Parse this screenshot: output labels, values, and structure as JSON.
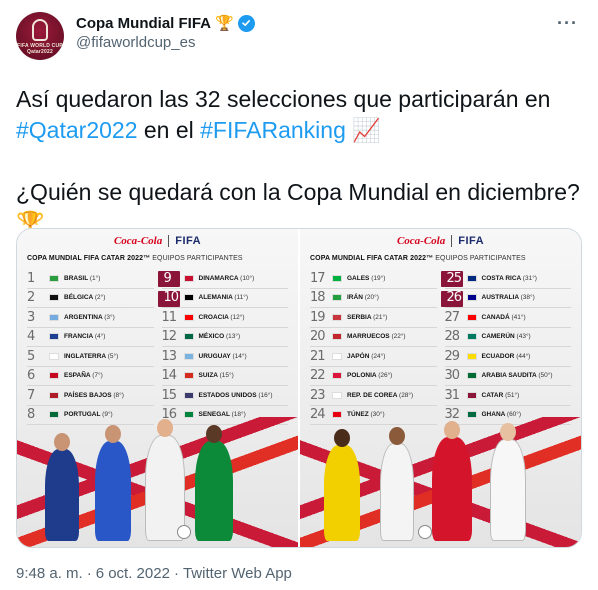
{
  "account": {
    "display_name": "Copa Mundial FIFA",
    "badge_emoji": "🏆",
    "handle": "@fifaworldcup_es",
    "avatar_text_1": "FIFA WORLD CUP",
    "avatar_text_2": "Qatar2022",
    "avatar_color": "#6d1027",
    "verified_color": "#1d9bf0"
  },
  "more_label": "···",
  "tweet": {
    "line1_a": "Así quedaron las 32 selecciones que participarán en",
    "hashtag1": "#Qatar2022",
    "line2_mid": " en el ",
    "hashtag2": "#FIFARanking",
    "chart_emoji": "📈",
    "line3": "¿Quién se quedará con la Copa Mundial en diciembre?",
    "trophy_emoji": "🏆",
    "hashtag_color": "#1d9bf0"
  },
  "media": {
    "panels": [
      {
        "brand_coke": "Coca-Cola",
        "brand_fifa": "FIFA",
        "title_bold": "COPA MUNDIAL FIFA CATAR 2022™",
        "title_light": "EQUIPOS PARTICIPANTES",
        "teams": [
          {
            "rank": "1",
            "name": "BRASIL",
            "pos": "(1°)",
            "flag": "#2a9d3f",
            "hl": false
          },
          {
            "rank": "2",
            "name": "BÉLGICA",
            "pos": "(2°)",
            "flag": "#111111",
            "hl": false
          },
          {
            "rank": "3",
            "name": "ARGENTINA",
            "pos": "(3°)",
            "flag": "#74acdf",
            "hl": false
          },
          {
            "rank": "4",
            "name": "FRANCIA",
            "pos": "(4°)",
            "flag": "#1f3f95",
            "hl": false
          },
          {
            "rank": "5",
            "name": "INGLATERRA",
            "pos": "(5°)",
            "flag": "#ffffff",
            "hl": false
          },
          {
            "rank": "6",
            "name": "ESPAÑA",
            "pos": "(7°)",
            "flag": "#c60b1e",
            "hl": false
          },
          {
            "rank": "7",
            "name": "PAÍSES BAJOS",
            "pos": "(8°)",
            "flag": "#ae1c28",
            "hl": false
          },
          {
            "rank": "8",
            "name": "PORTUGAL",
            "pos": "(9°)",
            "flag": "#046a38",
            "hl": false
          },
          {
            "rank": "9",
            "name": "DINAMARCA",
            "pos": "(10°)",
            "flag": "#c8102e",
            "hl": true
          },
          {
            "rank": "10",
            "name": "ALEMANIA",
            "pos": "(11°)",
            "flag": "#000000",
            "hl": true
          },
          {
            "rank": "11",
            "name": "CROACIA",
            "pos": "(12°)",
            "flag": "#ff0000",
            "hl": false
          },
          {
            "rank": "12",
            "name": "MÉXICO",
            "pos": "(13°)",
            "flag": "#006847",
            "hl": false
          },
          {
            "rank": "13",
            "name": "URUGUAY",
            "pos": "(14°)",
            "flag": "#7bb3e0",
            "hl": false
          },
          {
            "rank": "14",
            "name": "SUIZA",
            "pos": "(15°)",
            "flag": "#d52b1e",
            "hl": false
          },
          {
            "rank": "15",
            "name": "ESTADOS UNIDOS",
            "pos": "(16°)",
            "flag": "#3c3b6e",
            "hl": false
          },
          {
            "rank": "16",
            "name": "SENEGAL",
            "pos": "(18°)",
            "flag": "#00853f",
            "hl": false
          }
        ]
      },
      {
        "brand_coke": "Coca-Cola",
        "brand_fifa": "FIFA",
        "title_bold": "COPA MUNDIAL FIFA CATAR 2022™",
        "title_light": "EQUIPOS PARTICIPANTES",
        "teams": [
          {
            "rank": "17",
            "name": "GALES",
            "pos": "(19°)",
            "flag": "#00b140",
            "hl": false
          },
          {
            "rank": "18",
            "name": "IRÁN",
            "pos": "(20°)",
            "flag": "#239f40",
            "hl": false
          },
          {
            "rank": "19",
            "name": "SERBIA",
            "pos": "(21°)",
            "flag": "#c6363c",
            "hl": false
          },
          {
            "rank": "20",
            "name": "MARRUECOS",
            "pos": "(22°)",
            "flag": "#c1272d",
            "hl": false
          },
          {
            "rank": "21",
            "name": "JAPÓN",
            "pos": "(24°)",
            "flag": "#ffffff",
            "hl": false
          },
          {
            "rank": "22",
            "name": "POLONIA",
            "pos": "(26°)",
            "flag": "#dc143c",
            "hl": false
          },
          {
            "rank": "23",
            "name": "REP. DE COREA",
            "pos": "(28°)",
            "flag": "#ffffff",
            "hl": false
          },
          {
            "rank": "24",
            "name": "TÚNEZ",
            "pos": "(30°)",
            "flag": "#e70013",
            "hl": false
          },
          {
            "rank": "25",
            "name": "COSTA RICA",
            "pos": "(31°)",
            "flag": "#002b7f",
            "hl": true
          },
          {
            "rank": "26",
            "name": "AUSTRALIA",
            "pos": "(38°)",
            "flag": "#00008b",
            "hl": true
          },
          {
            "rank": "27",
            "name": "CANADÁ",
            "pos": "(41°)",
            "flag": "#ff0000",
            "hl": false
          },
          {
            "rank": "28",
            "name": "CAMERÚN",
            "pos": "(43°)",
            "flag": "#007a5e",
            "hl": false
          },
          {
            "rank": "29",
            "name": "ECUADOR",
            "pos": "(44°)",
            "flag": "#ffdd00",
            "hl": false
          },
          {
            "rank": "30",
            "name": "ARABIA SAUDITA",
            "pos": "(50°)",
            "flag": "#006c35",
            "hl": false
          },
          {
            "rank": "31",
            "name": "CATAR",
            "pos": "(51°)",
            "flag": "#8a1538",
            "hl": false
          },
          {
            "rank": "32",
            "name": "GHANA",
            "pos": "(60°)",
            "flag": "#006b3f",
            "hl": false
          }
        ]
      }
    ]
  },
  "meta": {
    "time": "9:48 a. m.",
    "date": "6 oct. 2022",
    "source": "Twitter Web App",
    "separator": "·"
  }
}
